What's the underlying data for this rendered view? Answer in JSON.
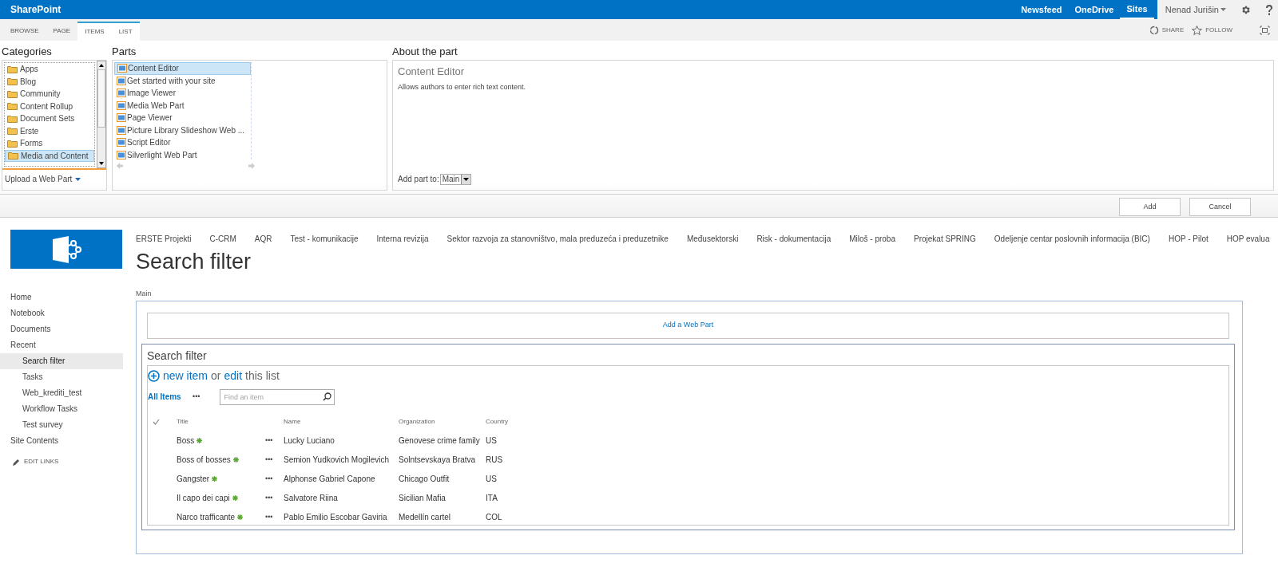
{
  "top_bar": {
    "brand": "SharePoint",
    "links": [
      {
        "label": "Newsfeed",
        "selected": false
      },
      {
        "label": "OneDrive",
        "selected": false
      },
      {
        "label": "Sites",
        "selected": true
      }
    ],
    "user": "Nenad Jurišin"
  },
  "ribbon": {
    "tabs": [
      {
        "label": "BROWSE",
        "selected": false
      },
      {
        "label": "PAGE",
        "selected": false
      },
      {
        "label": "ITEMS",
        "selected": true
      },
      {
        "label": "LIST",
        "selected": true
      }
    ],
    "actions": [
      "SHARE",
      "FOLLOW"
    ]
  },
  "gallery": {
    "categories": {
      "heading": "Categories",
      "items": [
        {
          "label": "Apps",
          "selected": false
        },
        {
          "label": "Blog",
          "selected": false
        },
        {
          "label": "Community",
          "selected": false
        },
        {
          "label": "Content Rollup",
          "selected": false
        },
        {
          "label": "Document Sets",
          "selected": false
        },
        {
          "label": "Erste",
          "selected": false
        },
        {
          "label": "Forms",
          "selected": false
        },
        {
          "label": "Media and Content",
          "selected": true
        }
      ],
      "upload": "Upload a Web Part"
    },
    "parts": {
      "heading": "Parts",
      "items": [
        {
          "label": "Content Editor",
          "selected": true
        },
        {
          "label": "Get started with your site",
          "selected": false
        },
        {
          "label": "Image Viewer",
          "selected": false
        },
        {
          "label": "Media Web Part",
          "selected": false
        },
        {
          "label": "Page Viewer",
          "selected": false
        },
        {
          "label": "Picture Library Slideshow Web ...",
          "selected": false
        },
        {
          "label": "Script Editor",
          "selected": false
        },
        {
          "label": "Silverlight Web Part",
          "selected": false
        }
      ]
    },
    "about": {
      "heading": "About the part",
      "title": "Content Editor",
      "description": "Allows authors to enter rich text content.",
      "add_to_label": "Add part to:",
      "add_to_value": "Main"
    },
    "buttons": [
      "Add",
      "Cancel"
    ]
  },
  "site": {
    "top_nav": [
      "ERSTE Projekti",
      "C-CRM",
      "AQR",
      "Test - komunikacije",
      "Interna revizija",
      "Sektor razvoja za stanovništvo, mala preduzeća i preduzetnike",
      "Međusektorski",
      "Risk - dokumentacija",
      "Miloš - proba",
      "Projekat SPRING",
      "Odeljenje centar poslovnih informacija (BIC)",
      "HOP - Pilot",
      "HOP evalua"
    ],
    "title": "Search filter",
    "quick_launch": [
      {
        "label": "Home",
        "selected": false
      },
      {
        "label": "Notebook",
        "selected": false
      },
      {
        "label": "Documents",
        "selected": false
      },
      {
        "label": "Recent",
        "selected": false,
        "children": [
          {
            "label": "Search filter",
            "selected": true
          },
          {
            "label": "Tasks",
            "selected": false
          },
          {
            "label": "Web_krediti_test",
            "selected": false
          },
          {
            "label": "Workflow Tasks",
            "selected": false
          },
          {
            "label": "Test survey",
            "selected": false
          }
        ]
      },
      {
        "label": "Site Contents",
        "selected": false
      }
    ],
    "edit_links": "EDIT LINKS"
  },
  "zone": {
    "label": "Main",
    "add_web_part": "Add a Web Part",
    "list": {
      "title": "Search filter",
      "new_item": "new item",
      "or": "or",
      "edit": "edit",
      "this_list": "this list",
      "view": "All Items",
      "view_menu": "•••",
      "search_placeholder": "Find an item",
      "columns": [
        "Title",
        "Name",
        "Organization",
        "Country"
      ],
      "rows": [
        {
          "title": "Boss",
          "new": true,
          "menu": "•••",
          "name": "Lucky Luciano",
          "organization": "Genovese crime family",
          "country": "US"
        },
        {
          "title": "Boss of bosses",
          "new": true,
          "menu": "•••",
          "name": "Semion Yudkovich Mogilevich",
          "organization": "Solntsevskaya Bratva",
          "country": "RUS"
        },
        {
          "title": "Gangster",
          "new": true,
          "menu": "•••",
          "name": "Alphonse Gabriel Capone",
          "organization": "Chicago Outfit",
          "country": "US"
        },
        {
          "title": "Il capo dei capi",
          "new": true,
          "menu": "•••",
          "name": "Salvatore Riina",
          "organization": "Sicilian Mafia",
          "country": "ITA"
        },
        {
          "title": "Narco trafficante",
          "new": true,
          "menu": "•••",
          "name": "Pablo Emilio Escobar Gaviria",
          "organization": "Medellín cartel",
          "country": "COL"
        }
      ]
    }
  }
}
